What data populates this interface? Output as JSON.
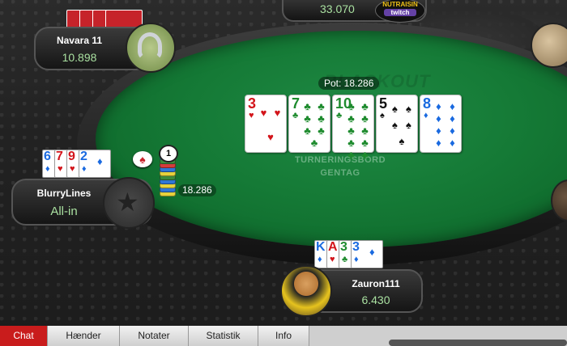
{
  "pot_label": "Pot: 18.286",
  "felt_lines": [
    "TURNERINGSBORD",
    "GENTAG"
  ],
  "felt_logo_text": "BLACKOUT",
  "bet_amount": "18.286",
  "dealer_button": "1",
  "board": [
    {
      "rank": "3",
      "suit": "♥",
      "color": "red"
    },
    {
      "rank": "7",
      "suit": "♣",
      "color": "green"
    },
    {
      "rank": "10",
      "suit": "♣",
      "color": "green"
    },
    {
      "rank": "5",
      "suit": "♠",
      "color": "black"
    },
    {
      "rank": "8",
      "suit": "♦",
      "color": "blue"
    }
  ],
  "players": {
    "navara": {
      "name": "Navara 11",
      "stack": "10.898"
    },
    "top": {
      "stack": "33.070",
      "badge_top": "NUTRAISIN",
      "badge_bottom": "twitch"
    },
    "blurry": {
      "name": "BlurryLines",
      "stack": "All-in",
      "cards": [
        {
          "rank": "6",
          "suit": "♦",
          "color": "blue"
        },
        {
          "rank": "7",
          "suit": "♥",
          "color": "red"
        },
        {
          "rank": "9",
          "suit": "♥",
          "color": "red"
        },
        {
          "rank": "2",
          "suit": "♦",
          "color": "blue"
        }
      ]
    },
    "hero": {
      "name": "Zauron111",
      "stack": "6.430",
      "cards": [
        {
          "rank": "K",
          "suit": "♦",
          "color": "blue"
        },
        {
          "rank": "A",
          "suit": "♥",
          "color": "red"
        },
        {
          "rank": "3",
          "suit": "♣",
          "color": "green"
        },
        {
          "rank": "3",
          "suit": "♦",
          "color": "blue"
        }
      ]
    }
  },
  "tabs": [
    "Chat",
    "Hænder",
    "Notater",
    "Statistik",
    "Info"
  ],
  "colors": {
    "felt": "#157a36",
    "active_tab": "#c91c1c",
    "stack_text": "#a9e0a0"
  }
}
